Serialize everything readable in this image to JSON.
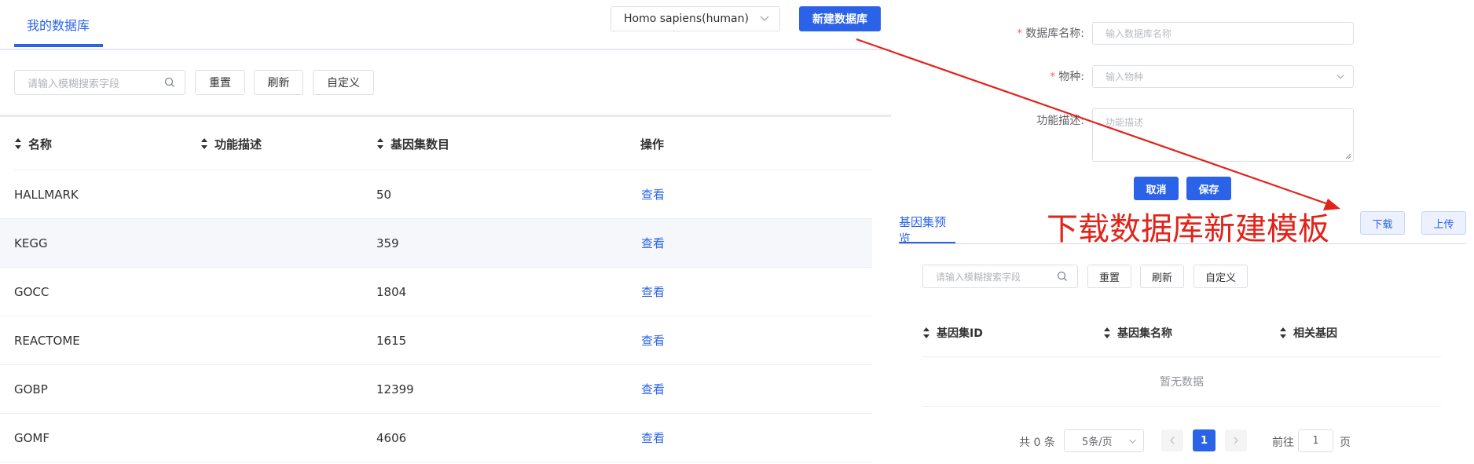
{
  "left": {
    "tab_label": "我的数据库",
    "species_select": {
      "value": "Homo sapiens(human)"
    },
    "new_db_button": "新建数据库",
    "toolbar": {
      "search_placeholder": "请输入模糊搜索字段",
      "reset": "重置",
      "refresh": "刷新",
      "custom": "自定义"
    },
    "table": {
      "columns": [
        "名称",
        "功能描述",
        "基因集数目",
        "操作"
      ],
      "rows": [
        {
          "name": "HALLMARK",
          "desc": "",
          "count": "50",
          "action": "查看"
        },
        {
          "name": "KEGG",
          "desc": "",
          "count": "359",
          "action": "查看"
        },
        {
          "name": "GOCC",
          "desc": "",
          "count": "1804",
          "action": "查看"
        },
        {
          "name": "REACTOME",
          "desc": "",
          "count": "1615",
          "action": "查看"
        },
        {
          "name": "GOBP",
          "desc": "",
          "count": "12399",
          "action": "查看"
        },
        {
          "name": "GOMF",
          "desc": "",
          "count": "4606",
          "action": "查看"
        }
      ]
    }
  },
  "right": {
    "form": {
      "db_name_label": "数据库名称:",
      "db_name_placeholder": "输入数据库名称",
      "species_label": "物种:",
      "species_placeholder": "输入物种",
      "desc_label": "功能描述:",
      "desc_placeholder": "功能描述",
      "cancel": "取消",
      "save": "保存"
    },
    "preview_tab": "基因集预览",
    "download": "下载",
    "upload": "上传",
    "toolbar": {
      "search_placeholder": "请输入模糊搜索字段",
      "reset": "重置",
      "refresh": "刷新",
      "custom": "自定义"
    },
    "table": {
      "columns": [
        "基因集ID",
        "基因集名称",
        "相关基因"
      ],
      "empty_text": "暂无数据"
    },
    "pagination": {
      "total": "共 0 条",
      "page_size": "5条/页",
      "current_page": "1",
      "goto_prefix": "前往",
      "goto_value": "1",
      "goto_suffix": "页"
    }
  },
  "annotation": {
    "text": "下载数据库新建模板",
    "color": "#e2231a"
  },
  "colors": {
    "primary": "#2b63e8",
    "required": "#f56c6c"
  }
}
